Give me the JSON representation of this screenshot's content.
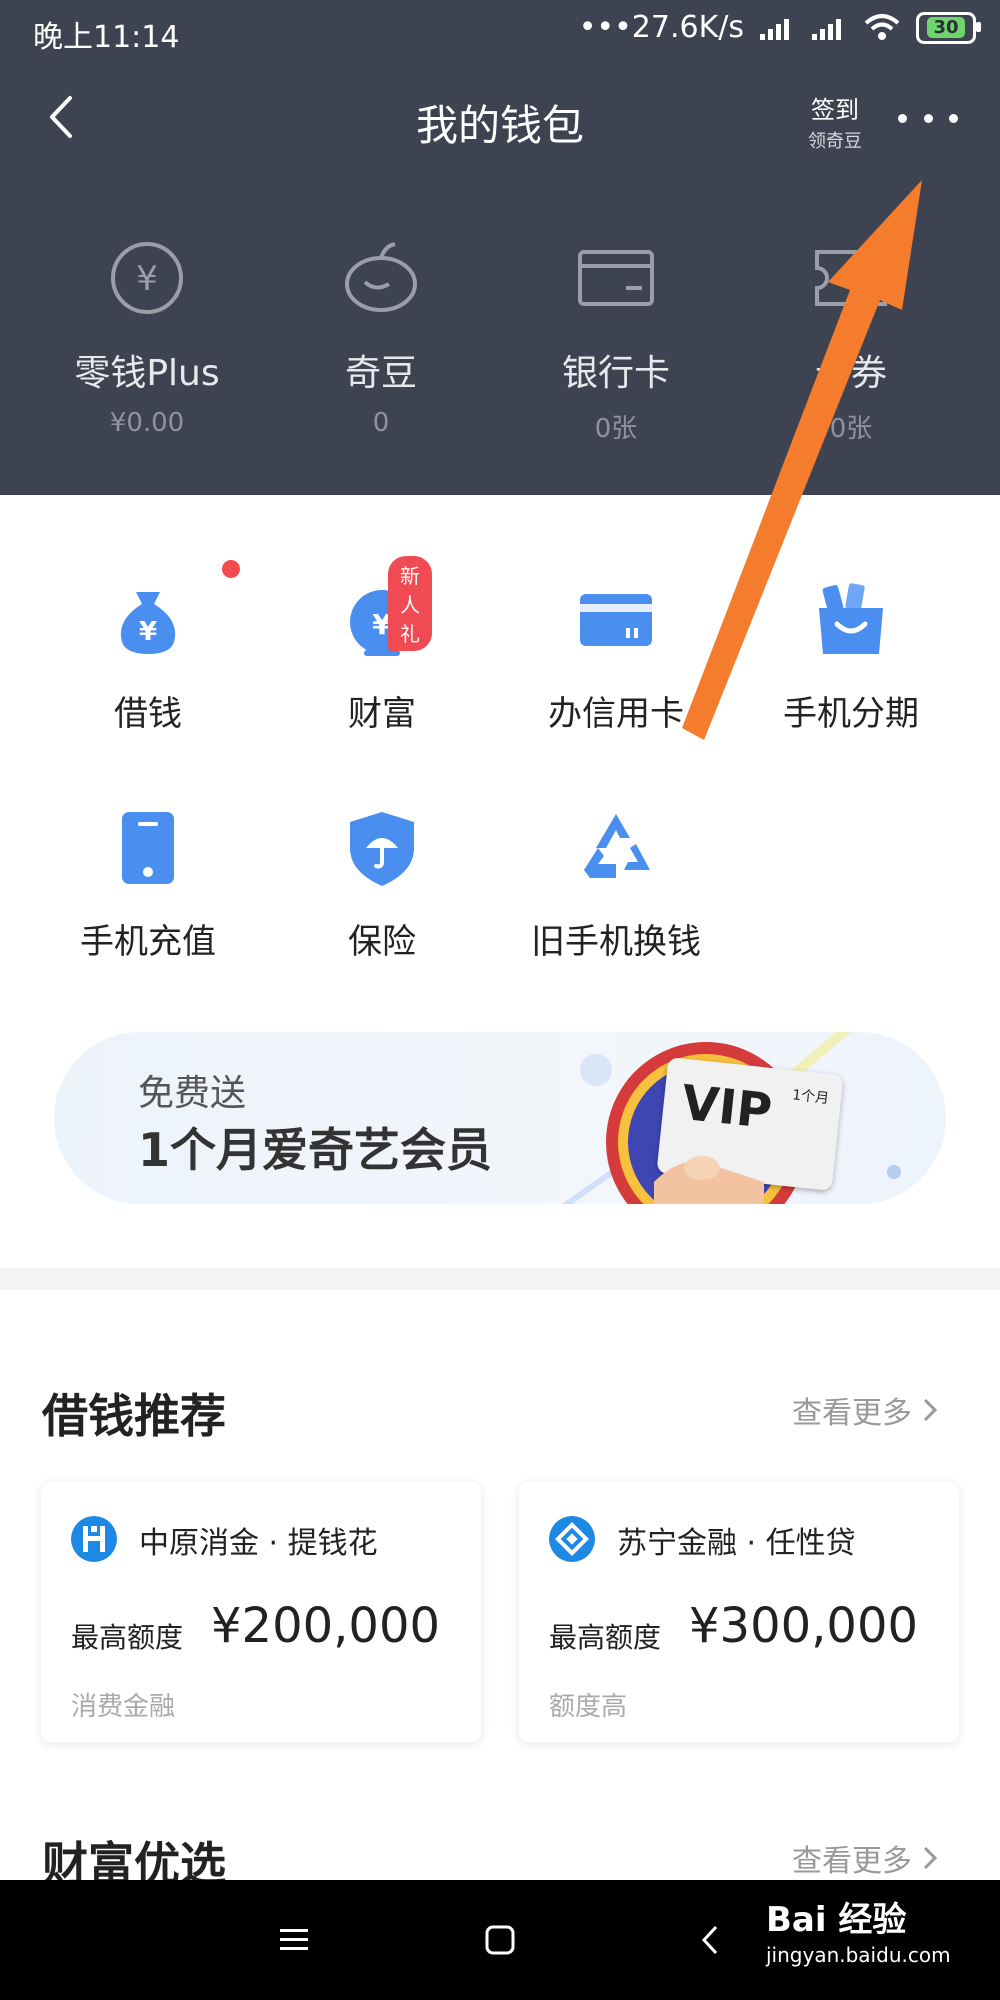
{
  "status_bar": {
    "time": "晚上11:14",
    "network_speed": "•••27.6K/s",
    "battery": "30"
  },
  "header": {
    "title": "我的钱包",
    "signin_line1": "签到",
    "signin_line2": "领奇豆"
  },
  "wallet_items": [
    {
      "label": "零钱Plus",
      "value": "¥0.00",
      "icon": "yen-circle-icon"
    },
    {
      "label": "奇豆",
      "value": "0",
      "icon": "bean-icon"
    },
    {
      "label": "银行卡",
      "value": "0张",
      "icon": "bank-card-icon"
    },
    {
      "label": "卡券",
      "value": "0张",
      "icon": "coupon-icon"
    }
  ],
  "services": [
    {
      "label": "借钱",
      "icon": "money-bag-icon"
    },
    {
      "label": "财富",
      "icon": "piggy-bank-icon",
      "badge": "新人礼"
    },
    {
      "label": "办信用卡",
      "icon": "credit-card-icon"
    },
    {
      "label": "手机分期",
      "icon": "shopping-bag-icon"
    },
    {
      "label": "手机充值",
      "icon": "phone-icon"
    },
    {
      "label": "保险",
      "icon": "shield-umbrella-icon"
    },
    {
      "label": "旧手机换钱",
      "icon": "recycle-icon"
    }
  ],
  "banner": {
    "subtitle": "免费送",
    "title": "1个月爱奇艺会员",
    "card_text": "VIP",
    "card_small": "1个月"
  },
  "loan_section": {
    "title": "借钱推荐",
    "more": "查看更多",
    "cards": [
      {
        "name": "中原消金 · 提钱花",
        "amount_label": "最高额度",
        "amount": "¥200,000",
        "tag": "消费金融",
        "color": "#1e88e5"
      },
      {
        "name": "苏宁金融 · 任性贷",
        "amount_label": "最高额度",
        "amount": "¥300,000",
        "tag": "额度高",
        "color": "#1e88e5"
      }
    ]
  },
  "wealth_section": {
    "title": "财富优选",
    "more": "查看更多"
  },
  "watermark": {
    "line1": "Bai 经验",
    "line2": "jingyan.baidu.com"
  },
  "colors": {
    "header_bg": "#3e4351",
    "accent_blue": "#4a8ef0",
    "badge_red": "#f04b52",
    "arrow_orange": "#f57c2c"
  }
}
